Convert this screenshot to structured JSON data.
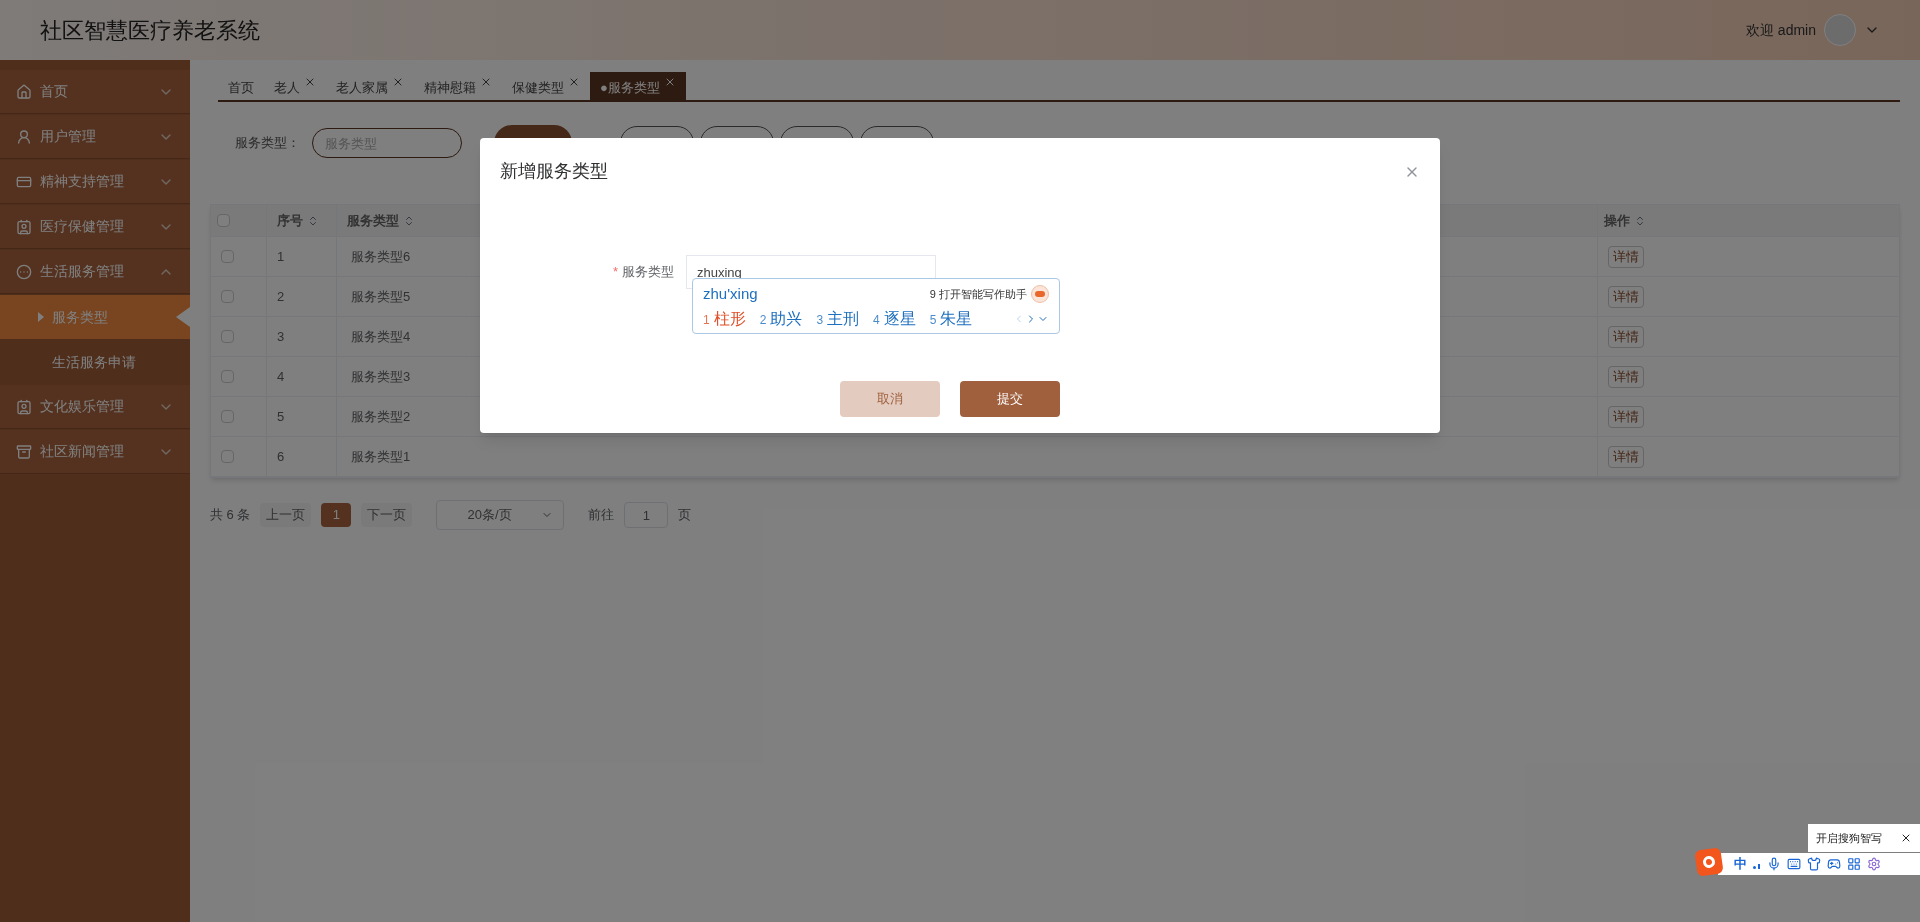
{
  "header": {
    "title": "社区智慧医疗养老系统",
    "welcome": "欢迎 admin"
  },
  "sidebar": {
    "items": [
      {
        "label": "首页",
        "expanded": false
      },
      {
        "label": "用户管理",
        "expanded": false
      },
      {
        "label": "精神支持管理",
        "expanded": false
      },
      {
        "label": "医疗保健管理",
        "expanded": false
      },
      {
        "label": "生活服务管理",
        "expanded": true,
        "children": [
          {
            "label": "服务类型",
            "selected": true
          },
          {
            "label": "生活服务申请",
            "selected": false
          }
        ]
      },
      {
        "label": "文化娱乐管理",
        "expanded": false
      },
      {
        "label": "社区新闻管理",
        "expanded": false
      }
    ]
  },
  "tabs": [
    {
      "label": "首页",
      "selected": false,
      "closable": false
    },
    {
      "label": "老人",
      "selected": false,
      "closable": true
    },
    {
      "label": "老人家属",
      "selected": false,
      "closable": true
    },
    {
      "label": "精神慰籍",
      "selected": false,
      "closable": true
    },
    {
      "label": "保健类型",
      "selected": false,
      "closable": true
    },
    {
      "label": "●服务类型",
      "selected": true,
      "closable": true
    }
  ],
  "search": {
    "label": "服务类型：",
    "placeholder": "服务类型"
  },
  "table": {
    "all_checked": false,
    "columns": [
      {
        "label": "序号",
        "sortable": true
      },
      {
        "label": "服务类型",
        "sortable": true
      },
      {
        "label": "操作",
        "sortable": true
      }
    ],
    "rows": [
      {
        "checked": false,
        "cells": [
          "1",
          "服务类型6"
        ],
        "action": "详情"
      },
      {
        "checked": false,
        "cells": [
          "2",
          "服务类型5"
        ],
        "action": "详情"
      },
      {
        "checked": false,
        "cells": [
          "3",
          "服务类型4"
        ],
        "action": "详情"
      },
      {
        "checked": false,
        "cells": [
          "4",
          "服务类型3"
        ],
        "action": "详情"
      },
      {
        "checked": false,
        "cells": [
          "5",
          "服务类型2"
        ],
        "action": "详情"
      },
      {
        "checked": false,
        "cells": [
          "6",
          "服务类型1"
        ],
        "action": "详情"
      }
    ]
  },
  "pagination": {
    "total": "共 6 条",
    "prev": "上一页",
    "pages": [
      {
        "label": "1",
        "selected": true
      }
    ],
    "next": "下一页",
    "page_size": "20条/页",
    "goto_label": "前往",
    "goto_value": "1",
    "page_suffix": "页"
  },
  "dialog": {
    "title": "新增服务类型",
    "field": {
      "required_mark": "*",
      "label": "服务类型",
      "value": "zhuxing"
    },
    "buttons": [
      {
        "label": "取消",
        "kind": "cancel"
      },
      {
        "label": "提交",
        "kind": "primary"
      }
    ]
  },
  "ime": {
    "composition": "zhu'xing",
    "assistant": "9 打开智能写作助手",
    "candidates": [
      {
        "index": "1",
        "text": "柱形",
        "selected": true
      },
      {
        "index": "2",
        "text": "助兴",
        "selected": false
      },
      {
        "index": "3",
        "text": "主刑",
        "selected": false
      },
      {
        "index": "4",
        "text": "逐星",
        "selected": false
      },
      {
        "index": "5",
        "text": "朱星",
        "selected": false
      }
    ]
  },
  "ime_toolbar": {
    "tip": "开启搜狗智写",
    "mode": "中"
  }
}
